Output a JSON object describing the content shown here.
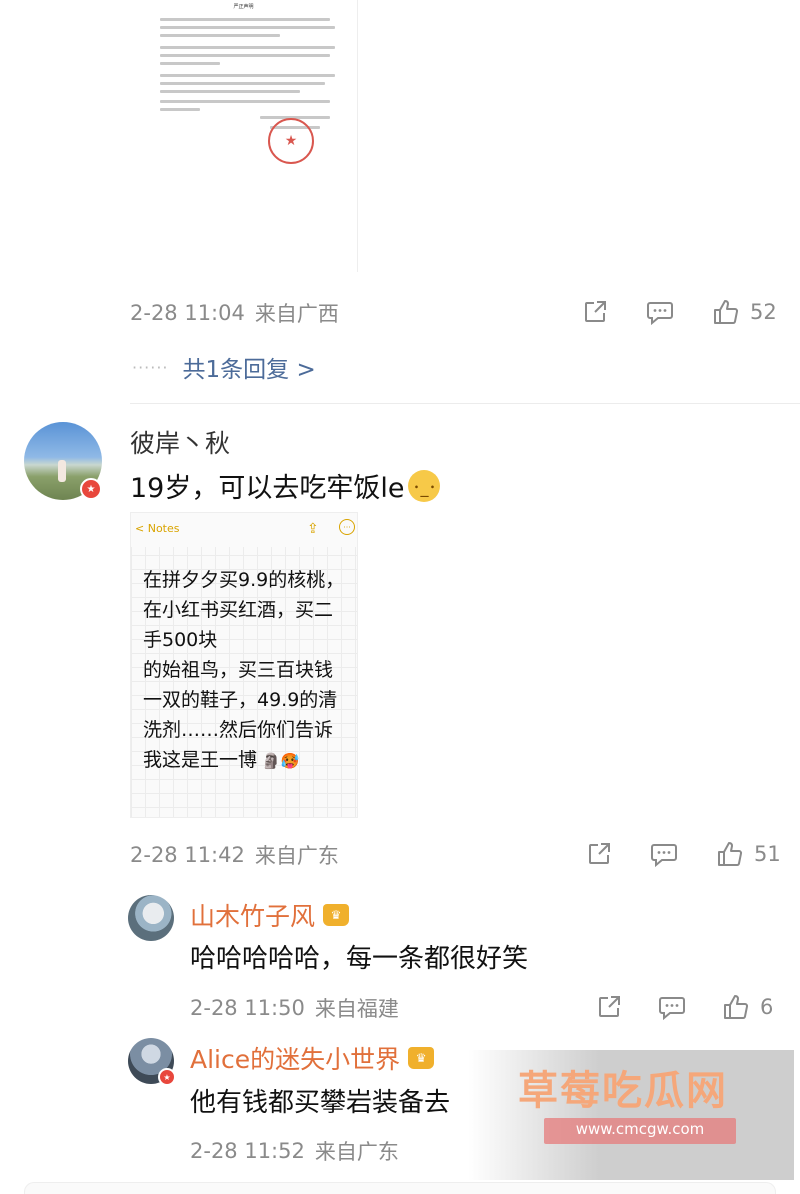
{
  "first_comment": {
    "doc_title": "严正声明",
    "timestamp": "2-28 11:04",
    "location": "来自广西",
    "likes": "52",
    "replies_link": "共1条回复 >",
    "replies_dots": "······"
  },
  "main_comment": {
    "username": "彼岸丶秋",
    "text": "19岁，可以去吃牢饭le",
    "notes_back": "< Notes",
    "notes_lines": [
      "在拼夕夕买9.9的核桃，",
      "在小红书买红酒，买二",
      "手500块",
      "的始祖鸟，买三百块钱",
      "一双的鞋子，49.9的清",
      "洗剂……然后你们告诉",
      "我这是王一博"
    ],
    "timestamp": "2-28 11:42",
    "location": "来自广东",
    "likes": "51"
  },
  "replies": [
    {
      "username": "山木竹子风",
      "text": "哈哈哈哈哈，每一条都很好笑",
      "timestamp": "2-28 11:50",
      "location": "来自福建",
      "likes": "6"
    },
    {
      "username": "Alice的迷失小世界",
      "text": "他有钱都买攀岩装备去",
      "timestamp": "2-28 11:52",
      "location": "来自广东"
    }
  ],
  "watermark": {
    "title": "草莓吃瓜网",
    "url": "www.cmcgw.com"
  },
  "colors": {
    "meta_gray": "#8a8a8a",
    "link_blue": "#4c6b99",
    "reply_name_orange": "#e1703b"
  }
}
